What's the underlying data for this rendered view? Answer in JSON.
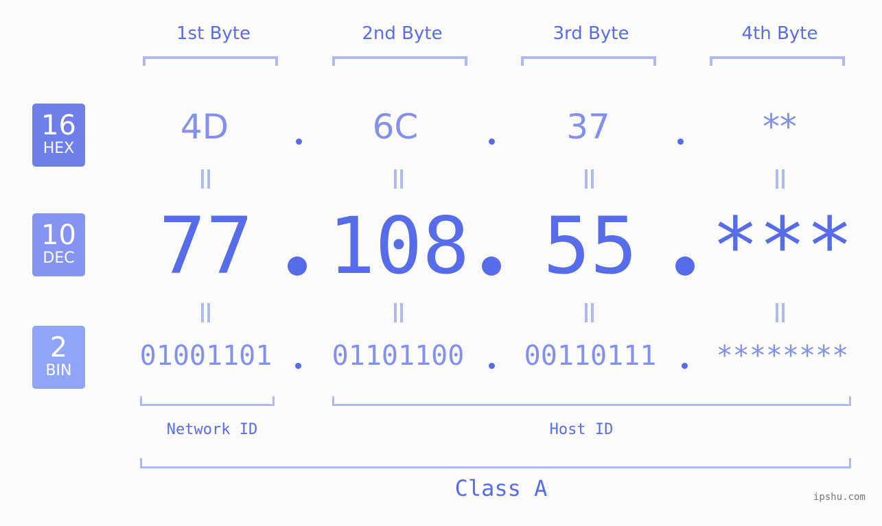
{
  "byte_headers": [
    "1st Byte",
    "2nd Byte",
    "3rd Byte",
    "4th Byte"
  ],
  "bases": [
    {
      "number": "16",
      "label": "HEX",
      "color": "#6f7fe9"
    },
    {
      "number": "10",
      "label": "DEC",
      "color": "#8494f0"
    },
    {
      "number": "2",
      "label": "BIN",
      "color": "#8fa6f7"
    }
  ],
  "hex_octets": [
    "4D",
    "6C",
    "37",
    "**"
  ],
  "dec_octets": [
    "77",
    "108",
    "55",
    "***"
  ],
  "bin_octets": [
    "01001101",
    "01101100",
    "00110111",
    "********"
  ],
  "separator": ".",
  "network_id_label": "Network ID",
  "host_id_label": "Host ID",
  "class_label": "Class A",
  "watermark": "ipshu.com",
  "colors": {
    "accent": "#576ce9",
    "light_value": "#8490ee",
    "bracket": "#b1b9f5",
    "background": "#fbfcfb"
  }
}
